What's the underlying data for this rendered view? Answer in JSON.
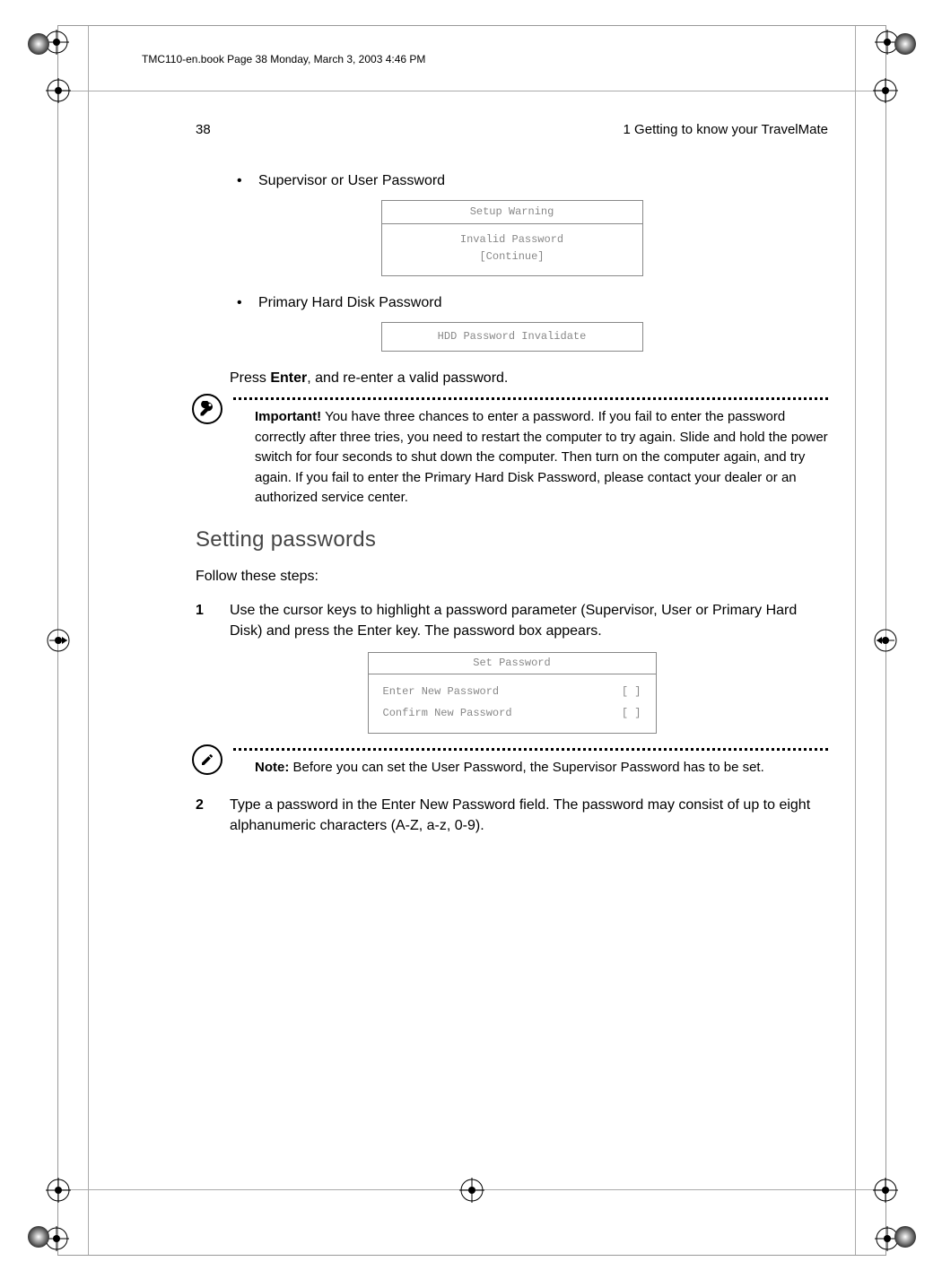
{
  "book_tag": "TMC110-en.book  Page 38  Monday, March 3, 2003  4:46 PM",
  "header": {
    "page_no": "38",
    "chapter": "1 Getting to know your TravelMate"
  },
  "bullets": {
    "b1": "Supervisor or User Password",
    "b2": "Primary Hard Disk Password"
  },
  "bios1": {
    "title": "Setup Warning",
    "line1": "Invalid Password",
    "line2": "[Continue]"
  },
  "bios2": {
    "line": "HDD Password Invalidate"
  },
  "press_enter": {
    "pre": "Press ",
    "key": "Enter",
    "post": ", and re-enter a valid password."
  },
  "important": {
    "label": "Important!",
    "text": "  You have three chances to enter a password.  If you fail to enter the password correctly after three tries, you need to restart the computer to try again.  Slide and hold the power switch for four seconds to shut down the computer.  Then turn on the computer again, and try again.  If you fail to enter the Primary Hard Disk Password, please contact your dealer or an authorized service center."
  },
  "section_heading": "Setting passwords",
  "lead": "Follow these steps:",
  "steps": {
    "s1": {
      "n": "1",
      "t": "Use the cursor keys to highlight a password parameter (Supervisor, User or Primary Hard Disk) and press the Enter key.  The password box appears."
    },
    "s2": {
      "n": "2",
      "t": "Type a password in the Enter New Password field.  The password may consist of up to eight alphanumeric characters (A-Z, a-z, 0-9)."
    }
  },
  "setpwd": {
    "title": "Set Password",
    "r1l": "Enter New Password",
    "r1r": "[        ]",
    "r2l": "Confirm New Password",
    "r2r": "[        ]"
  },
  "note": {
    "label": "Note:",
    "text": " Before you can set the User Password, the Supervisor Password has to be set."
  }
}
